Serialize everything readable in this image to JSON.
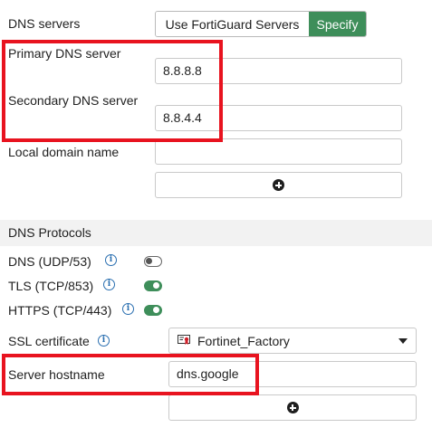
{
  "dns": {
    "servers_label": "DNS servers",
    "options": [
      "Use FortiGuard Servers",
      "Specify"
    ],
    "selected": "Specify",
    "primary_label": "Primary DNS server",
    "primary_value": "8.8.8.8",
    "secondary_label": "Secondary DNS server",
    "secondary_value": "8.8.4.4",
    "local_domain_label": "Local domain name",
    "local_domain_value": ""
  },
  "protocols": {
    "section_title": "DNS Protocols",
    "items": [
      {
        "label": "DNS (UDP/53)",
        "enabled": false
      },
      {
        "label": "TLS (TCP/853)",
        "enabled": true
      },
      {
        "label": "HTTPS (TCP/443)",
        "enabled": true
      }
    ],
    "ssl_label": "SSL certificate",
    "ssl_value": "Fortinet_Factory",
    "hostname_label": "Server hostname",
    "hostname_value": "dns.google"
  },
  "colors": {
    "accent_green": "#3e8e5a",
    "highlight_red": "#e8131f",
    "info_blue": "#2a6fb0"
  },
  "icons": {
    "add": "plus-circle-icon",
    "info": "info-icon",
    "certificate": "certificate-icon",
    "dropdown": "chevron-down-icon"
  }
}
